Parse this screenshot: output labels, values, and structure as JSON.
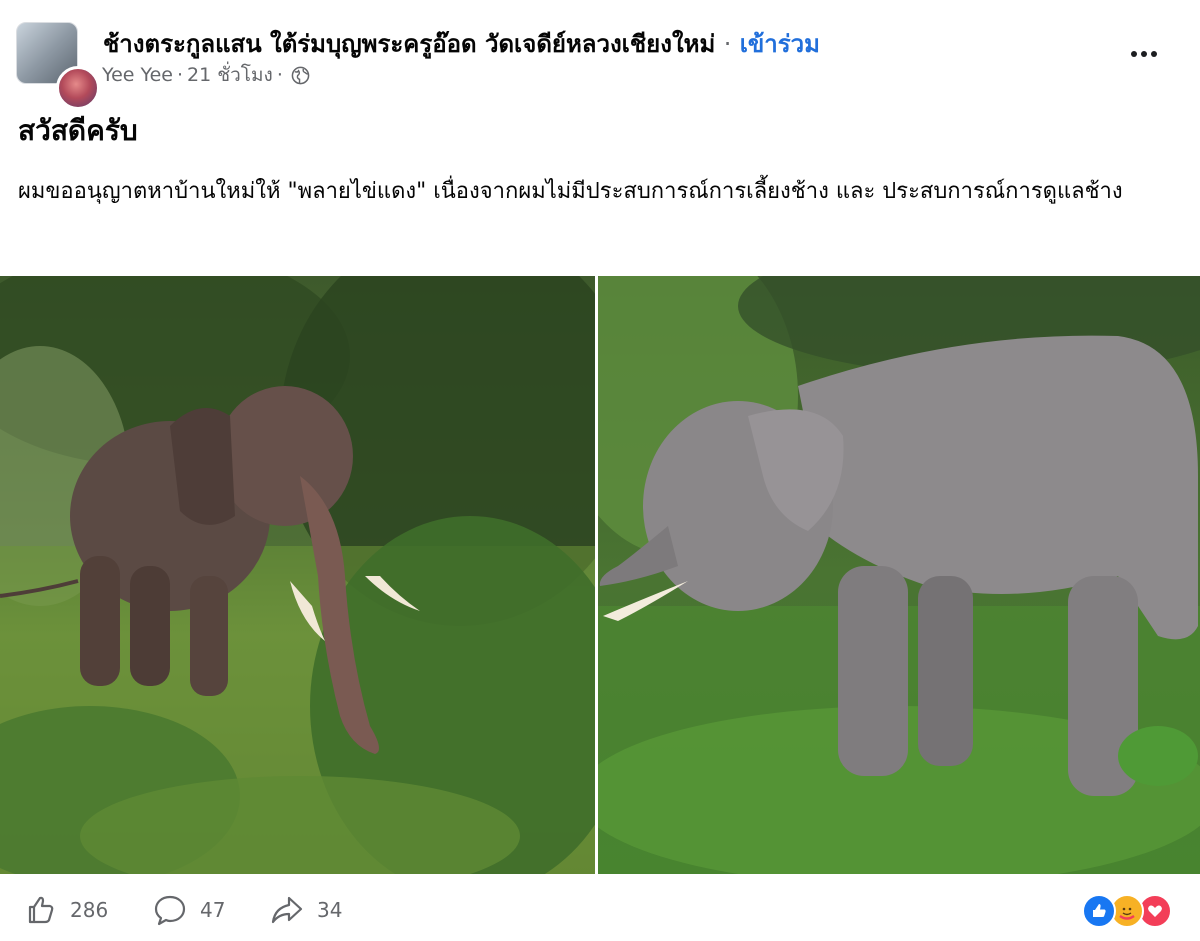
{
  "post": {
    "group_name": "ช้างตระกูลแสน ใต้ร่มบุญพระครูอ๊อด วัดเจดีย์หลวงเชียงใหม่",
    "separator": "·",
    "join_label": "เข้าร่วม",
    "author": "Yee Yee",
    "time": "21 ชั่วโมง",
    "meta_separator": "·",
    "globe_icon": "globe-icon",
    "greeting": "สวัสดีครับ",
    "body": "ผมขออนุญาตหาบ้านใหม่ให้ \"พลายไข่แดง\" เนื่องจากผมไม่มีประสบการณ์การเลี้ยงช้าง และ ประสบการณ์การดูแลช้าง"
  },
  "photos": [
    {
      "subject": "elephant-with-tusks-in-forest"
    },
    {
      "subject": "elephant-side-view-in-grass"
    }
  ],
  "footer": {
    "likes": "286",
    "comments": "47",
    "shares": "34",
    "like_icon": "thumbs-up-icon",
    "comment_icon": "comment-icon",
    "share_icon": "share-icon",
    "reactions": [
      "like",
      "care",
      "love"
    ]
  },
  "colors": {
    "link": "#216fdb",
    "secondary_text": "#65676b",
    "like_blue": "#1877f2",
    "love_red": "#f33e58",
    "care_yellow": "#f7b125"
  }
}
